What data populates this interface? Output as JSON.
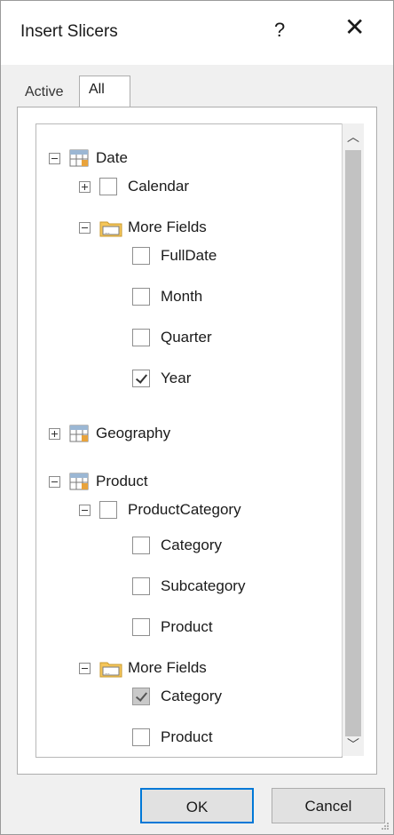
{
  "dialog": {
    "title": "Insert Slicers",
    "help_label": "?",
    "close_label": "✕"
  },
  "tabs": [
    {
      "label": "Active",
      "selected": false
    },
    {
      "label": "All",
      "selected": true
    }
  ],
  "tree": {
    "date": {
      "label": "Date",
      "calendar": "Calendar",
      "more_fields": "More Fields",
      "fields": [
        {
          "label": "FullDate",
          "checked": false
        },
        {
          "label": "Month",
          "checked": false
        },
        {
          "label": "Quarter",
          "checked": false
        },
        {
          "label": "Year",
          "checked": true
        }
      ]
    },
    "geography": {
      "label": "Geography"
    },
    "product": {
      "label": "Product",
      "category_group": "ProductCategory",
      "group_fields": [
        {
          "label": "Category",
          "checked": false
        },
        {
          "label": "Subcategory",
          "checked": false
        },
        {
          "label": "Product",
          "checked": false
        }
      ],
      "more_fields": "More Fields",
      "more_items": [
        {
          "label": "Category",
          "checked": true,
          "disabled": true
        },
        {
          "label": "Product",
          "checked": false
        }
      ]
    }
  },
  "buttons": {
    "ok": "OK",
    "cancel": "Cancel"
  },
  "icons": [
    "table-icon",
    "folder-icon",
    "expand-icon",
    "collapse-icon",
    "checkbox-icon",
    "scroll-up-icon",
    "scroll-down-icon",
    "resize-grip-icon"
  ]
}
